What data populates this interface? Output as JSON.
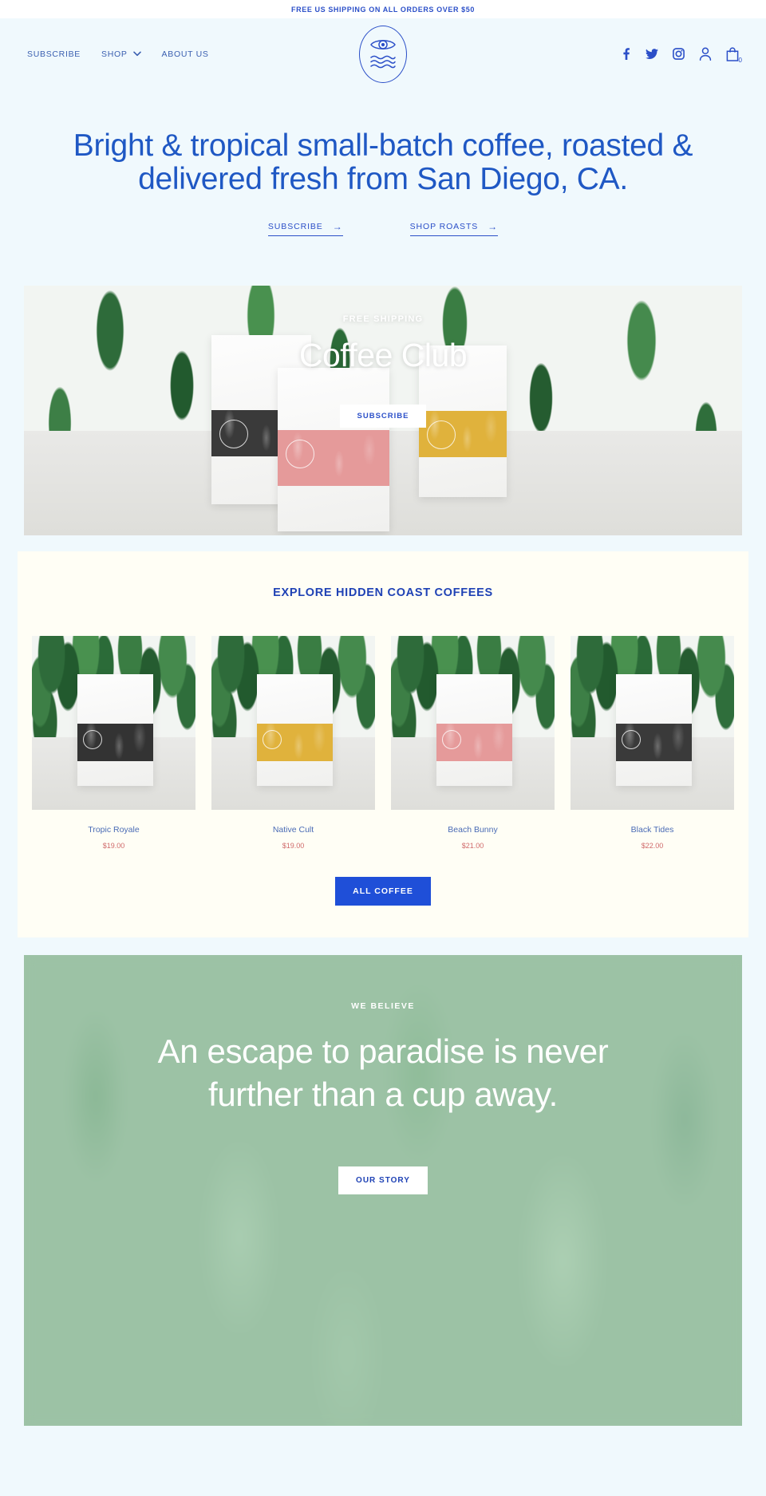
{
  "announcement": {
    "text": "FREE US SHIPPING ON ALL ORDERS OVER $50"
  },
  "header": {
    "nav": [
      {
        "label": "SUBSCRIBE",
        "has_chevron": false
      },
      {
        "label": "SHOP",
        "has_chevron": true
      },
      {
        "label": "ABOUT US",
        "has_chevron": false
      }
    ],
    "logo": {
      "icon": "eye-over-waves-oval-logo"
    },
    "social": [
      {
        "name": "facebook-icon"
      },
      {
        "name": "twitter-icon"
      },
      {
        "name": "instagram-icon"
      }
    ],
    "account": {
      "name": "account-person-icon"
    },
    "cart": {
      "name": "cart-bag-icon",
      "count": "0"
    }
  },
  "hero": {
    "title": "Bright & tropical small-batch coffee, roasted & delivered fresh from San Diego, CA.",
    "links": [
      {
        "label": "SUBSCRIBE",
        "arrow": "→"
      },
      {
        "label": "SHOP ROASTS",
        "arrow": "→"
      }
    ]
  },
  "banner": {
    "kicker": "FREE SHIPPING",
    "title": "Coffee Club",
    "button": "SUBSCRIBE"
  },
  "products_section": {
    "title": "EXPLORE HIDDEN COAST COFFEES",
    "items": [
      {
        "name": "Tropic Royale",
        "price": "$19.00",
        "label_color": "#333333"
      },
      {
        "name": "Native Cult",
        "price": "$19.00",
        "label_color": "#e0b23c"
      },
      {
        "name": "Beach Bunny",
        "price": "$21.00",
        "label_color": "#e59a9a"
      },
      {
        "name": "Black Tides",
        "price": "$22.00",
        "label_color": "#3a3a3a"
      }
    ],
    "button": "ALL COFFEE"
  },
  "believe": {
    "kicker": "WE BELIEVE",
    "title": "An escape to paradise is never further than a cup away.",
    "button": "OUR STORY"
  },
  "colors": {
    "brand_blue": "#2b4fc8",
    "title_blue": "#1f58c4",
    "page_bg": "#f0f9fd",
    "section_cream": "#fffef5",
    "price_red": "#d06a6a",
    "button_blue": "#1f4fd8"
  }
}
